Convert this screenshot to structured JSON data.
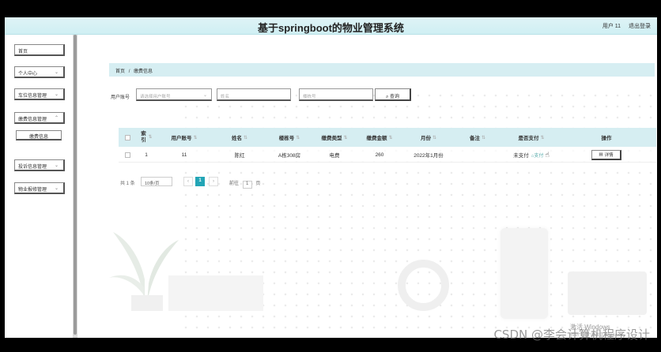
{
  "header": {
    "title": "基于springboot的物业管理系统",
    "user": "用户 11",
    "logout": "退出登录"
  },
  "sidebar": {
    "items": [
      {
        "label": "首页"
      },
      {
        "label": "个人中心"
      },
      {
        "label": "车位信息管理"
      },
      {
        "label": "缴费信息管理"
      },
      {
        "label": "缴费信息"
      },
      {
        "label": "投诉信息管理"
      },
      {
        "label": "物业报修管理"
      }
    ]
  },
  "breadcrumb": {
    "home": "首页",
    "sep": "/",
    "current": "缴费信息"
  },
  "search": {
    "label": "用户账号",
    "account_placeholder": "请选择用户账号",
    "name_placeholder": "姓名",
    "building_placeholder": "楼栋号",
    "query_label": "查询"
  },
  "table": {
    "columns": [
      "索引",
      "用户账号",
      "姓名",
      "楼栋号",
      "缴费类型",
      "缴费金额",
      "月份",
      "备注",
      "是否支付",
      "操作"
    ],
    "rows": [
      {
        "index": "1",
        "account": "11",
        "name": "陈红",
        "building": "A栋308房",
        "fee_type": "电费",
        "amount": "260",
        "month": "2022年1月份",
        "remark": "",
        "paid": "未支付",
        "pay_link": "支付",
        "action": "详情"
      }
    ]
  },
  "pagination": {
    "total": "共 1 条",
    "page_size": "10条/页",
    "current_page": "1",
    "goto_prefix": "前往",
    "goto_value": "1",
    "goto_suffix": "页"
  },
  "watermark": {
    "windows_title": "激活 Windows",
    "windows_sub": "转到\"设置\"以激活 Windows。",
    "csdn": "CSDN @李会计算机程序设计"
  }
}
